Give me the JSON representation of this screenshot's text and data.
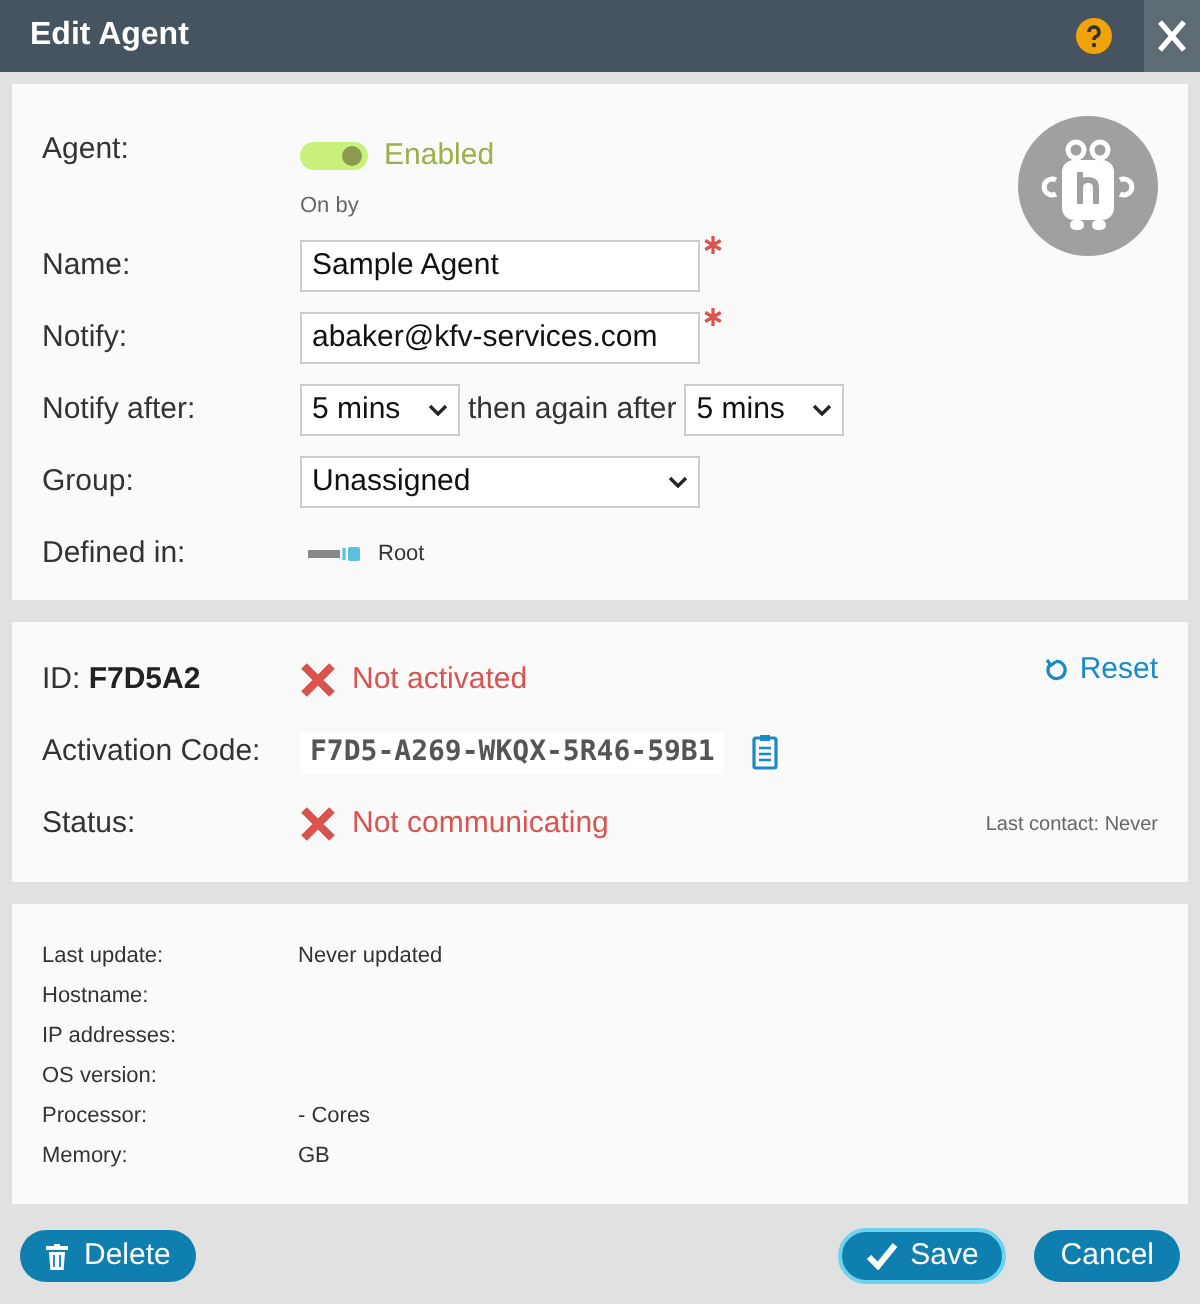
{
  "window": {
    "title": "Edit Agent"
  },
  "agent": {
    "label": "Agent:",
    "enabled": true,
    "status": "Enabled",
    "note": "On by"
  },
  "fields": [
    {
      "kind": "input",
      "label": "Name:",
      "value": "Sample Agent",
      "required": true
    },
    {
      "kind": "input",
      "label": "Notify:",
      "value": "abaker@kfv-services.com",
      "required": true
    },
    {
      "kind": "notify",
      "label": "Notify after:",
      "first": "5 mins",
      "between": "then again after",
      "second": "5 mins"
    },
    {
      "kind": "select",
      "label": "Group:",
      "value": "Unassigned"
    },
    {
      "kind": "defined",
      "label": "Defined in:",
      "value": "Root"
    }
  ],
  "activation": {
    "id_label": "ID:",
    "id": "F7D5A2",
    "activated": false,
    "activation_status": "Not activated",
    "reset": "Reset",
    "code_label": "Activation Code:",
    "code": "F7D5-A269-WKQX-5R46-59B1",
    "status_label": "Status:",
    "communicating": false,
    "status": "Not communicating",
    "last_contact": "Last contact: Never"
  },
  "details": [
    {
      "label": "Last update:",
      "value": "Never updated"
    },
    {
      "label": "Hostname:"
    },
    {
      "label": "IP addresses:"
    },
    {
      "label": "OS version:"
    },
    {
      "label": "Processor:",
      "value": "- Cores"
    },
    {
      "label": "Memory:",
      "value": "GB"
    }
  ],
  "buttons": [
    {
      "kind": "delete",
      "label": "Delete"
    },
    {
      "kind": "save",
      "label": "Save"
    },
    {
      "kind": "cancel",
      "label": "Cancel"
    }
  ]
}
